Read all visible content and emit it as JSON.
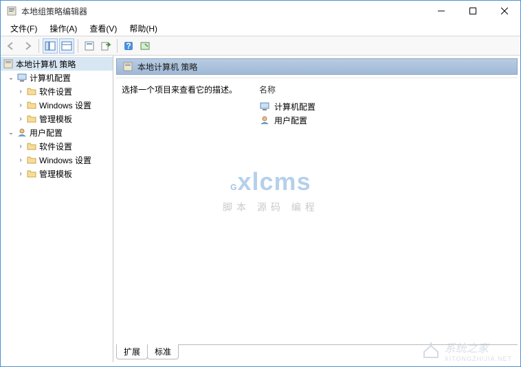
{
  "window": {
    "title": "本地组策略编辑器"
  },
  "menu": {
    "file": "文件(F)",
    "action": "操作(A)",
    "view": "查看(V)",
    "help": "帮助(H)"
  },
  "tree": {
    "root": "本地计算机 策略",
    "computer_config": "计算机配置",
    "software_settings": "软件设置",
    "windows_settings": "Windows 设置",
    "admin_templates": "管理模板",
    "user_config": "用户配置"
  },
  "right": {
    "header": "本地计算机 策略",
    "description": "选择一个项目来查看它的描述。",
    "name_header": "名称",
    "items": {
      "computer_config": "计算机配置",
      "user_config": "用户配置"
    }
  },
  "tabs": {
    "extended": "扩展",
    "standard": "标准"
  },
  "watermark": {
    "brand": "Gxlcms",
    "subtitle": "脚本 源码 编程",
    "corner_text": "系统之家",
    "corner_sub": "XITONGZHIJIA.NET"
  }
}
